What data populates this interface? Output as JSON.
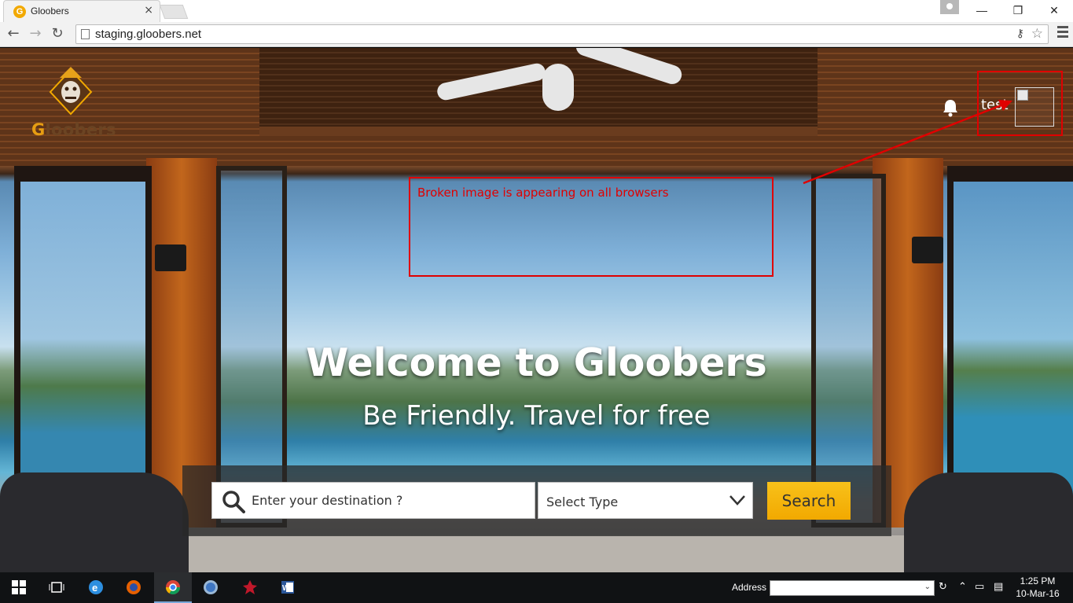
{
  "browser": {
    "tab_title": "Gloobers",
    "tab_close": "×",
    "url": "staging.gloobers.net",
    "window_controls": {
      "minimize": "—",
      "maximize": "❐",
      "close": "✕"
    }
  },
  "site": {
    "logo_text_g": "G",
    "logo_text_rest": "loobers",
    "header": {
      "username": "test"
    },
    "hero": {
      "title": "Welcome to Gloobers",
      "subtitle": "Be Friendly. Travel for free"
    },
    "search": {
      "destination_placeholder": "Enter your destination ?",
      "type_value": "Select Type",
      "button_label": "Search"
    }
  },
  "annotation": {
    "text": "Broken image is appearing on all browsers",
    "color": "#e00000"
  },
  "taskbar": {
    "address_label": "Address",
    "time": "1:25 PM",
    "date": "10-Mar-16",
    "pinned_apps": [
      "start-icon",
      "task-view-icon",
      "edge-icon",
      "firefox-icon",
      "chrome-icon",
      "safari-icon",
      "app-icon",
      "word-icon"
    ]
  },
  "colors": {
    "accent_yellow": "#f2a900",
    "brand_brown": "#6b4423"
  }
}
